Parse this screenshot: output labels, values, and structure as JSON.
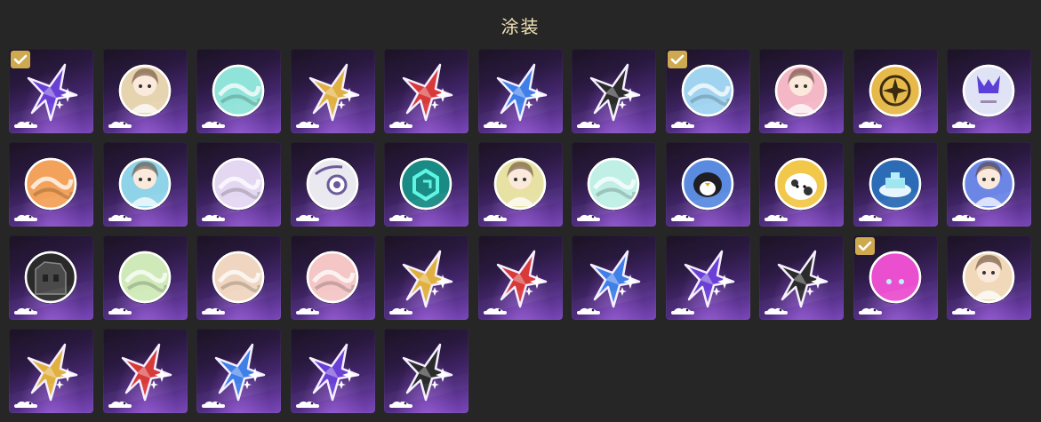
{
  "title": "涂装",
  "colors": {
    "background": "#262626",
    "title": "#f2e3b6",
    "check": "#cfa94f"
  },
  "items": [
    {
      "icon": "star-emblem-icon",
      "color": "#6a3fd6",
      "checked": true
    },
    {
      "icon": "anime-portrait-icon",
      "color": "#e6d3b0",
      "checked": false
    },
    {
      "icon": "teal-orb-icon",
      "color": "#8fe3d8",
      "checked": false
    },
    {
      "icon": "star-emblem-icon",
      "color": "#e0b040",
      "checked": false
    },
    {
      "icon": "star-emblem-icon",
      "color": "#d83a3a",
      "checked": false
    },
    {
      "icon": "star-emblem-icon",
      "color": "#3f7fe8",
      "checked": false
    },
    {
      "icon": "star-emblem-icon",
      "color": "#2b2b2b",
      "checked": false
    },
    {
      "icon": "wave-orb-icon",
      "color": "#9fd3f0",
      "checked": true
    },
    {
      "icon": "anime-portrait-icon",
      "color": "#f3b7c6",
      "checked": false
    },
    {
      "icon": "compass-badge-icon",
      "color": "#e6b94a",
      "checked": false
    },
    {
      "icon": "mech-helmet-icon",
      "color": "#dfe3f5",
      "checked": false
    },
    {
      "icon": "crystal-orb-icon",
      "color": "#f2a25a",
      "checked": false
    },
    {
      "icon": "anime-portrait-icon",
      "color": "#8fd3e8",
      "checked": false
    },
    {
      "icon": "dragon-orb-icon",
      "color": "#e4d7f2",
      "checked": false
    },
    {
      "icon": "eye-orb-icon",
      "color": "#e9e9ef",
      "checked": false
    },
    {
      "icon": "neon-cube-icon",
      "color": "#1a8a85",
      "checked": false
    },
    {
      "icon": "anime-portrait-icon",
      "color": "#e7e1a3",
      "checked": false
    },
    {
      "icon": "swirl-orb-icon",
      "color": "#bfefe5",
      "checked": false
    },
    {
      "icon": "penguin-icon",
      "color": "#5b8be0",
      "checked": false
    },
    {
      "icon": "cow-icon",
      "color": "#f2c84a",
      "checked": false
    },
    {
      "icon": "cloud-city-icon",
      "color": "#2c6bb5",
      "checked": false
    },
    {
      "icon": "anime-portrait-icon",
      "color": "#6c86e6",
      "checked": false
    },
    {
      "icon": "dark-building-icon",
      "color": "#2a2a2a",
      "checked": false
    },
    {
      "icon": "leaf-orb-icon",
      "color": "#cfeab8",
      "checked": false
    },
    {
      "icon": "bunny-icon",
      "color": "#f0d6c0",
      "checked": false
    },
    {
      "icon": "ghost-creature-icon",
      "color": "#f4c6c6",
      "checked": false
    },
    {
      "icon": "star-emblem-icon",
      "color": "#e0b040",
      "checked": false
    },
    {
      "icon": "star-emblem-icon",
      "color": "#d83a3a",
      "checked": false
    },
    {
      "icon": "star-emblem-icon",
      "color": "#3f7fe8",
      "checked": false
    },
    {
      "icon": "star-emblem-icon",
      "color": "#6a3fd6",
      "checked": false
    },
    {
      "icon": "star-emblem-icon",
      "color": "#2b2b2b",
      "checked": false
    },
    {
      "icon": "pink-cat-icon",
      "color": "#ea4fd0",
      "checked": true
    },
    {
      "icon": "anime-portrait-icon",
      "color": "#f0d8b8",
      "checked": false
    },
    {
      "icon": "star-emblem-icon",
      "color": "#e0b040",
      "checked": false
    },
    {
      "icon": "star-emblem-icon",
      "color": "#d83a3a",
      "checked": false
    },
    {
      "icon": "star-emblem-icon",
      "color": "#3f7fe8",
      "checked": false
    },
    {
      "icon": "star-emblem-icon",
      "color": "#6a3fd6",
      "checked": false
    },
    {
      "icon": "star-emblem-icon",
      "color": "#2b2b2b",
      "checked": false
    }
  ]
}
